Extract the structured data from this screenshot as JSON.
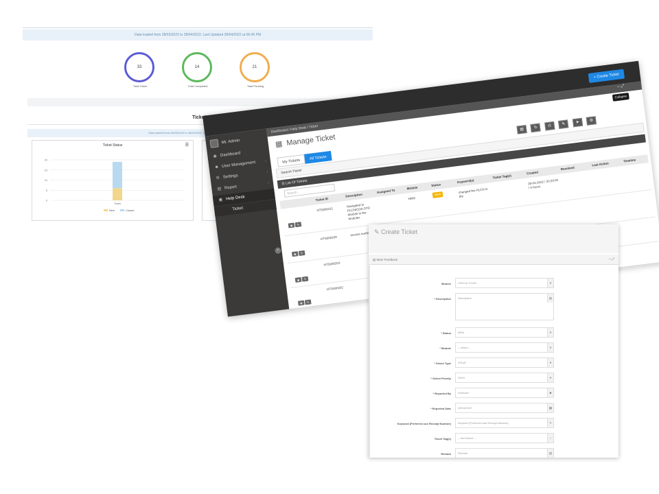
{
  "dashboard": {
    "info_line": "Data loaded from 28/03/2022 to 28/04/2022. Last Updated 28/04/2022 at 06:45 PM",
    "kpis": [
      {
        "value": "33",
        "label": "Total Ticket",
        "color": "#5b5bd6"
      },
      {
        "value": "14",
        "label": "Total Completed",
        "color": "#5cb85c"
      },
      {
        "value": "21",
        "label": "Total Pending",
        "color": "#f0ad4e"
      }
    ],
    "download_icon": "download-icon",
    "section_title": "Ticket",
    "info_line2": "Data loaded from 28/03/2022 to 28/04/2022. Last Updated 28/04/2022 at 06:45 PM",
    "chart_card_title": "Ticket Status",
    "chart_menu_icon": "hamburger-menu-icon"
  },
  "chart_data": {
    "type": "bar",
    "title": "Ticket Status",
    "categories": [
      "Ticket"
    ],
    "series": [
      {
        "name": "New",
        "values": [
          6
        ],
        "color": "#f0d78c"
      },
      {
        "name": "Closed",
        "values": [
          13
        ],
        "color": "#b8d9f0"
      }
    ],
    "stacked": true,
    "y_ticks": [
      "0",
      "5",
      "10",
      "15",
      "20"
    ],
    "ylim": [
      0,
      20
    ],
    "legend_position": "bottom"
  },
  "manage": {
    "user_name": "Mr. Admin",
    "sidebar": [
      {
        "label": "Dashboard",
        "icon": "dashboard-icon"
      },
      {
        "label": "User Management",
        "icon": "users-icon"
      },
      {
        "label": "Settings",
        "icon": "gear-icon"
      },
      {
        "label": "Report",
        "icon": "report-icon"
      },
      {
        "label": "Help Desk",
        "icon": "helpdesk-icon"
      }
    ],
    "sidebar_sub": "Ticket",
    "breadcrumb": "Dashboard  /  Help Desk  /  Ticket",
    "create_button": "+ Create Ticket",
    "collapse_tooltip": "Collapse",
    "page_title": "Manage Ticket",
    "tabs": [
      "My Tickets",
      "All Tickets"
    ],
    "search_panel": "Search Panel",
    "list_header": "List Of Tickets",
    "search_placeholder": "Search...",
    "columns": [
      "Ticket ID",
      "Description",
      "Assigned To",
      "Module",
      "Status",
      "Keyword(s)",
      "Ticket Tag(s)",
      "Created",
      "Resolved",
      "Last Action",
      "Timeline"
    ],
    "rows": [
      {
        "id": "HTS000211",
        "desc": "Navigated to PLCN/COA DTD Module in the Modules",
        "module": "HRM",
        "status": "NEW",
        "keyword": "changed the PLCN in the",
        "created": "28-04-2022 / 20:20:05 / 4 hours",
        "resolved": "28-04-2022 / 20:20:05 / 4 hours"
      },
      {
        "id": "HTS000209",
        "desc": "Invoice number issue",
        "module": "",
        "status": "",
        "keyword": "",
        "created": "",
        "resolved": ""
      },
      {
        "id": "HTS000203",
        "desc": "",
        "module": "",
        "status": "",
        "keyword": "",
        "created": "",
        "resolved": ""
      },
      {
        "id": "HTS000202",
        "desc": "",
        "module": "",
        "status": "",
        "keyword": "",
        "created": "",
        "resolved": ""
      }
    ]
  },
  "create": {
    "title": "Create Ticket",
    "form_header": "Main Feedback",
    "fields": [
      {
        "label": "Branch",
        "value": "CIRCLE FOUR"
      },
      {
        "label": "* Description",
        "value": "Description"
      },
      {
        "label": "* Status",
        "value": "NEW"
      },
      {
        "label": "* Module",
        "value": "-- select --"
      },
      {
        "label": "* Select Type",
        "value": "ISSUE"
      },
      {
        "label": "* Select Priority",
        "value": "HIGH"
      },
      {
        "label": "* Reported By",
        "value": "Subhash"
      },
      {
        "label": "* Reported Date",
        "value": "28/04/2022"
      },
      {
        "label": "Keyword (Preferred use Receipt Number)",
        "value": "Keyword (Preferred use Receipt Number)"
      },
      {
        "label": "Ticket Tag(s)",
        "value": "-- Not Select --"
      },
      {
        "label": "Remark",
        "value": "Remark"
      }
    ]
  }
}
